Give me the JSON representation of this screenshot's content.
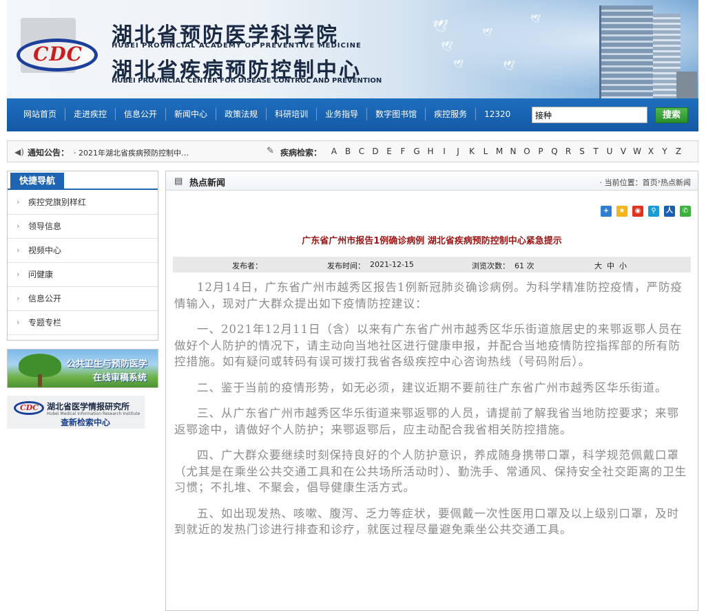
{
  "header": {
    "org_cn_1": "湖北省预防医学科学院",
    "org_en_1": "HUBEI PROVINCIAL ACADEMY OF PREVENTIVE MEDICINE",
    "org_cn_2": "湖北省疾病预防控制中心",
    "org_en_2": "HUBEI PROVINCIAL CENTER FOR DISEASE CONTROL AND PREVENTION",
    "logo_text": "CDC"
  },
  "nav": {
    "items": [
      "网站首页",
      "走进疾控",
      "信息公开",
      "新闻中心",
      "政策法规",
      "科研培训",
      "业务指导",
      "数字图书馆",
      "疾控服务",
      "12320"
    ],
    "search_value": "接种",
    "search_button": "搜索"
  },
  "notice": {
    "label": "通知公告：",
    "text": "· 2021年湖北省疾病预防控制中…",
    "disease_label": "疾病检索：",
    "letters": [
      "A",
      "B",
      "C",
      "D",
      "E",
      "F",
      "G",
      "H",
      "I",
      "J",
      "K",
      "L",
      "M",
      "N",
      "O",
      "P",
      "Q",
      "R",
      "S",
      "T",
      "U",
      "V",
      "W",
      "X",
      "Y",
      "Z"
    ]
  },
  "sidebar": {
    "title": "快捷导航",
    "items": [
      "疾控党旗别样红",
      "领导信息",
      "视频中心",
      "问健康",
      "信息公开",
      "专题专栏"
    ],
    "ad1_line1": "公共卫生与预防医学",
    "ad1_line2": "在线审稿系统",
    "ad2_name": "湖北省医学情报研究所",
    "ad2_en": "Hubei Medical Information Research Institute",
    "ad2_sub": "查新检索中心"
  },
  "main": {
    "section_title": "热点新闻",
    "breadcrumb_prefix": "· 当前位置：",
    "breadcrumb_home": "首页",
    "breadcrumb_sep": " › ",
    "breadcrumb_current": "热点新闻",
    "share_icons": [
      "share-plus-icon",
      "qzone-icon",
      "weibo-icon",
      "qq-weibo-icon",
      "renren-icon",
      "wechat-icon"
    ],
    "article": {
      "title": "广东省广州市报告1例确诊病例 湖北省疾病预防控制中心紧急提示",
      "publisher_label": "发布者：",
      "date_label": "发布时间：",
      "date": "2021-12-15",
      "views_label": "浏览次数：",
      "views": "61 次",
      "size_large": "大",
      "size_medium": "中",
      "size_small": "小",
      "paragraphs": [
        "12月14日，广东省广州市越秀区报告1例新冠肺炎确诊病例。为科学精准防控疫情，严防疫情输入，现对广大群众提出如下疫情防控建议：",
        "一、2021年12月11日（含）以来有广东省广州市越秀区华乐街道旅居史的来鄂返鄂人员在做好个人防护的情况下，请主动向当地社区进行健康申报，并配合当地疫情防控指挥部的所有防控措施。如有疑问或转码有误可拨打我省各级疾控中心咨询热线（号码附后）。",
        "二、鉴于当前的疫情形势，如无必须，建议近期不要前往广东省广州市越秀区华乐街道。",
        "三、从广东省广州市越秀区华乐街道来鄂返鄂的人员，请提前了解我省当地防控要求；来鄂返鄂途中，请做好个人防护；来鄂返鄂后，应主动配合我省相关防控措施。",
        "四、广大群众要继续时刻保持良好的个人防护意识，养成随身携带口罩，科学规范佩戴口罩（尤其是在乘坐公共交通工具和在公共场所活动时）、勤洗手、常通风、保持安全社交距离的卫生习惯；不扎堆、不聚会，倡导健康生活方式。",
        "五、如出现发热、咳嗽、腹泻、乏力等症状，要佩戴一次性医用口罩及以上级别口罩，及时到就近的发热门诊进行排查和诊疗，就医过程尽量避免乘坐公共交通工具。"
      ]
    }
  },
  "colors": {
    "nav_blue": "#1d64b3",
    "article_title": "#9b1515",
    "search_green": "#2a8f2a"
  }
}
